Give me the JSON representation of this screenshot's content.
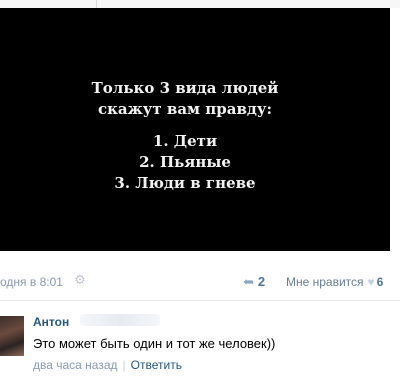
{
  "post": {
    "image_lines": [
      "Только 3 вида людей",
      "скажут вам правду:",
      "1. Дети",
      "2. Пьяные",
      "3. Люди в гневе"
    ],
    "date": "одня в 8:01",
    "share_count": "2",
    "like_label": "Мне нравится",
    "like_count": "6"
  },
  "comment": {
    "author": "Антон",
    "text": "Это может быть один и тот же человек))",
    "time": "два часа назад",
    "reply_label": "Ответить"
  },
  "icons": {
    "settings": "gear-icon",
    "share": "share-icon",
    "like": "heart-icon"
  }
}
